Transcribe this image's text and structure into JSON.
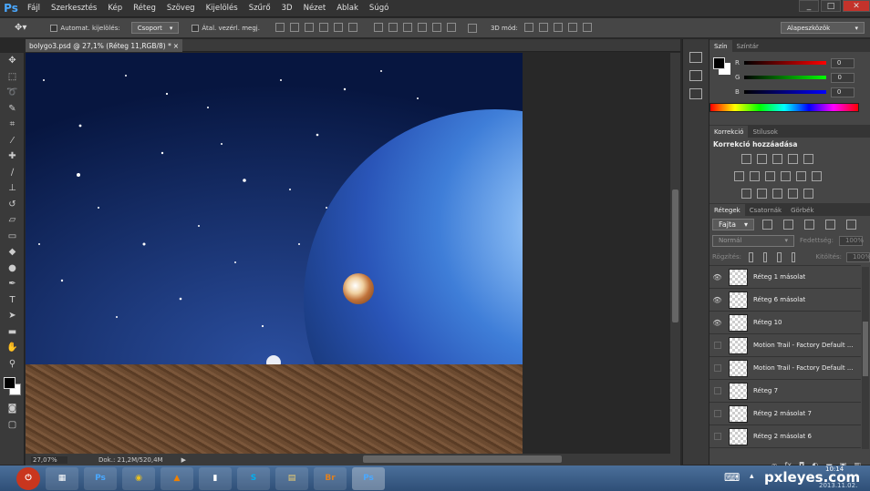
{
  "app": {
    "logo": "Ps"
  },
  "menu": [
    "Fájl",
    "Szerkesztés",
    "Kép",
    "Réteg",
    "Szöveg",
    "Kijelölés",
    "Szűrő",
    "3D",
    "Nézet",
    "Ablak",
    "Súgó"
  ],
  "window_controls": [
    "_",
    "□",
    "✕"
  ],
  "options": {
    "auto_select_label": "Automat. kijelölés:",
    "auto_select_value": "Csoport",
    "transform_label": "Átal. vezérl. megj.",
    "mode_3d_label": "3D mód:",
    "workspace": "Alapeszközök"
  },
  "document": {
    "tab_title": "bolygo3.psd @ 27,1% (Réteg 11,RGB/8) *",
    "tab_close": "×",
    "zoom": "27,07%",
    "doc_size": "Dok.: 21,2M/520,4M"
  },
  "color_panel": {
    "tabs": [
      "Szín",
      "Színtár"
    ],
    "channels": [
      {
        "name": "R",
        "value": "0",
        "color": "#e02020"
      },
      {
        "name": "G",
        "value": "0",
        "color": "#20c020"
      },
      {
        "name": "B",
        "value": "0",
        "color": "#2040e0"
      }
    ]
  },
  "adjustments_panel": {
    "tabs": [
      "Korrekció",
      "Stílusok"
    ],
    "title": "Korrekció hozzáadása"
  },
  "layers_panel": {
    "tabs": [
      "Rétegek",
      "Csatornák",
      "Görbék"
    ],
    "filter": "Fajta",
    "blend_mode": "Normál",
    "opacity_label": "Fedettség:",
    "opacity_value": "100%",
    "lock_label": "Rögzítés:",
    "fill_label": "Kitöltés:",
    "fill_value": "100%",
    "layers": [
      {
        "name": "Réteg 1 másolat",
        "visible": true
      },
      {
        "name": "Réteg 6 másolat",
        "visible": true
      },
      {
        "name": "Réteg 10",
        "visible": true
      },
      {
        "name": "Motion Trail - Factory Default ...",
        "visible": false
      },
      {
        "name": "Motion Trail - Factory Default ...",
        "visible": false
      },
      {
        "name": "Réteg 7",
        "visible": false
      },
      {
        "name": "Réteg 2 másolat 7",
        "visible": false
      },
      {
        "name": "Réteg 2 másolat 6",
        "visible": false
      }
    ]
  },
  "taskbar": {
    "apps": [
      "⏻",
      "▦",
      "Ps",
      "◉",
      "▲",
      "▮",
      "S",
      "▤",
      "Br",
      "Ps"
    ],
    "clock": "10:14",
    "date": "2013.11.02.",
    "watermark": "pxleyes.com"
  }
}
